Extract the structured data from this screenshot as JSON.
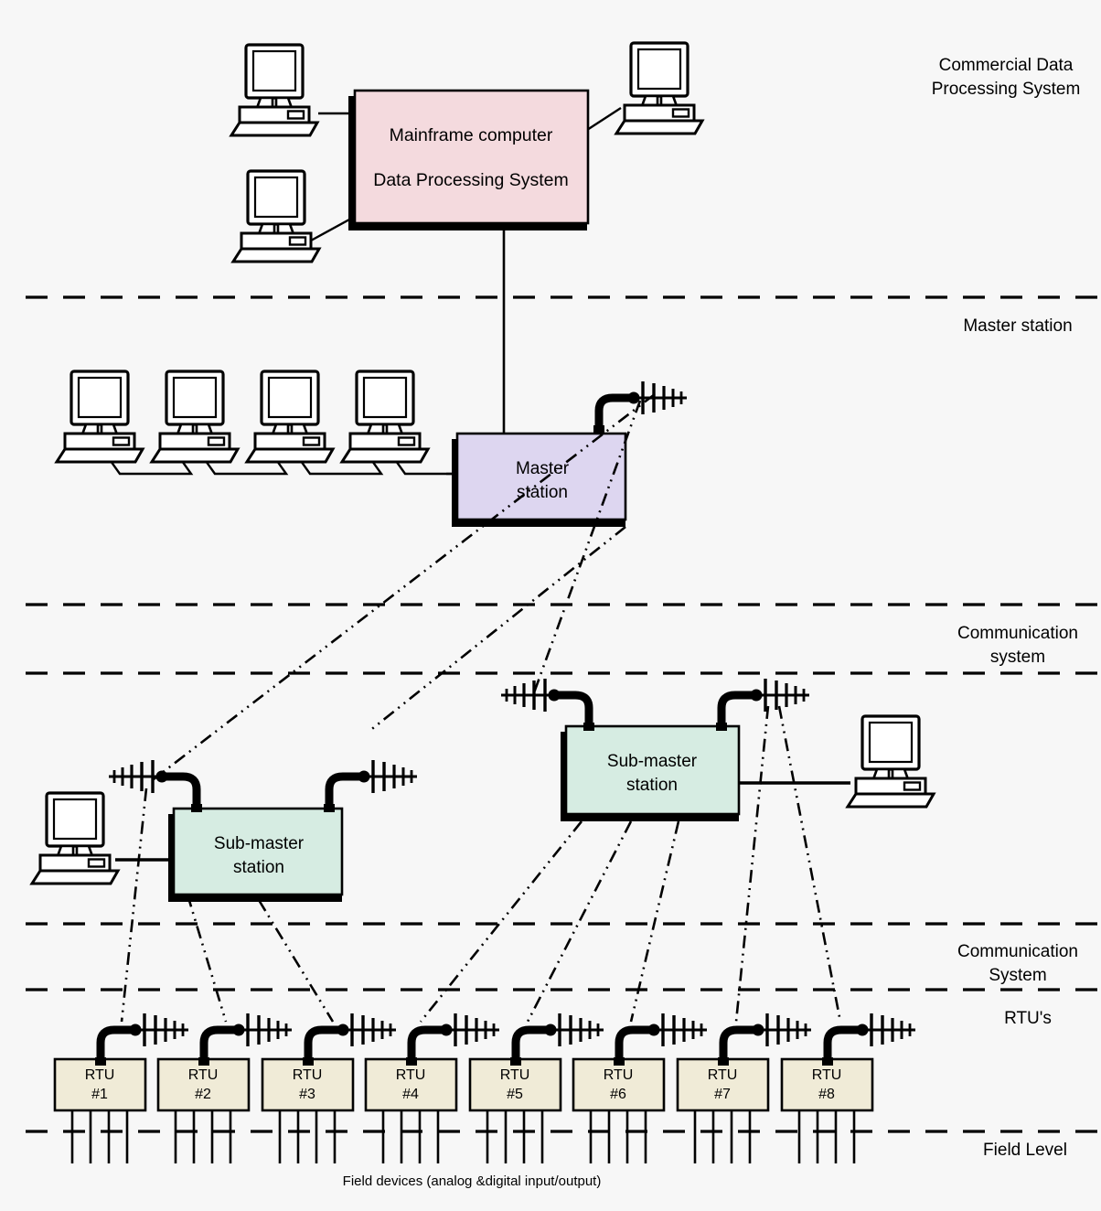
{
  "diagram": {
    "title": "SCADA system hierarchy diagram",
    "background_color": "#f7f7f7",
    "caption": "Field devices (analog &digital input/output)"
  },
  "level_labels": [
    {
      "id": "commercial",
      "line1": "Commercial Data",
      "line2": "Processing System"
    },
    {
      "id": "master-station",
      "line1": "Master station",
      "line2": ""
    },
    {
      "id": "communication-system-1",
      "line1": "Communication",
      "line2": "system"
    },
    {
      "id": "communication-system-2",
      "line1": "Communication",
      "line2": "System"
    },
    {
      "id": "rtus",
      "line1": "RTU's",
      "line2": ""
    },
    {
      "id": "field-level",
      "line1": "Field Level",
      "line2": ""
    }
  ],
  "nodes": {
    "mainframe": {
      "line1": "Mainframe computer",
      "line2": "Data Processing System",
      "fill": "#f4dade"
    },
    "master_station": {
      "line1": "Master",
      "line2": "station",
      "fill": "#ddd6f0"
    },
    "sub_master_left": {
      "line1": "Sub-master",
      "line2": "station",
      "fill": "#d6ece2"
    },
    "sub_master_right": {
      "line1": "Sub-master",
      "line2": "station",
      "fill": "#d6ece2"
    }
  },
  "rtus": {
    "fill": "#f0ebd7",
    "items": [
      {
        "line1": "RTU",
        "line2": "#1"
      },
      {
        "line1": "RTU",
        "line2": "#2"
      },
      {
        "line1": "RTU",
        "line2": "#3"
      },
      {
        "line1": "RTU",
        "line2": "#4"
      },
      {
        "line1": "RTU",
        "line2": "#5"
      },
      {
        "line1": "RTU",
        "line2": "#6"
      },
      {
        "line1": "RTU",
        "line2": "#7"
      },
      {
        "line1": "RTU",
        "line2": "#8"
      }
    ]
  },
  "colors": {
    "line": "#000000",
    "mainframe_fill": "#f4dade",
    "master_fill": "#ddd6f0",
    "submaster_fill": "#d6ece2",
    "rtu_fill": "#f0ebd7",
    "shadow": "#000000"
  },
  "icons": {
    "workstation": "computer-workstation-icon",
    "antenna": "radio-antenna-icon"
  }
}
